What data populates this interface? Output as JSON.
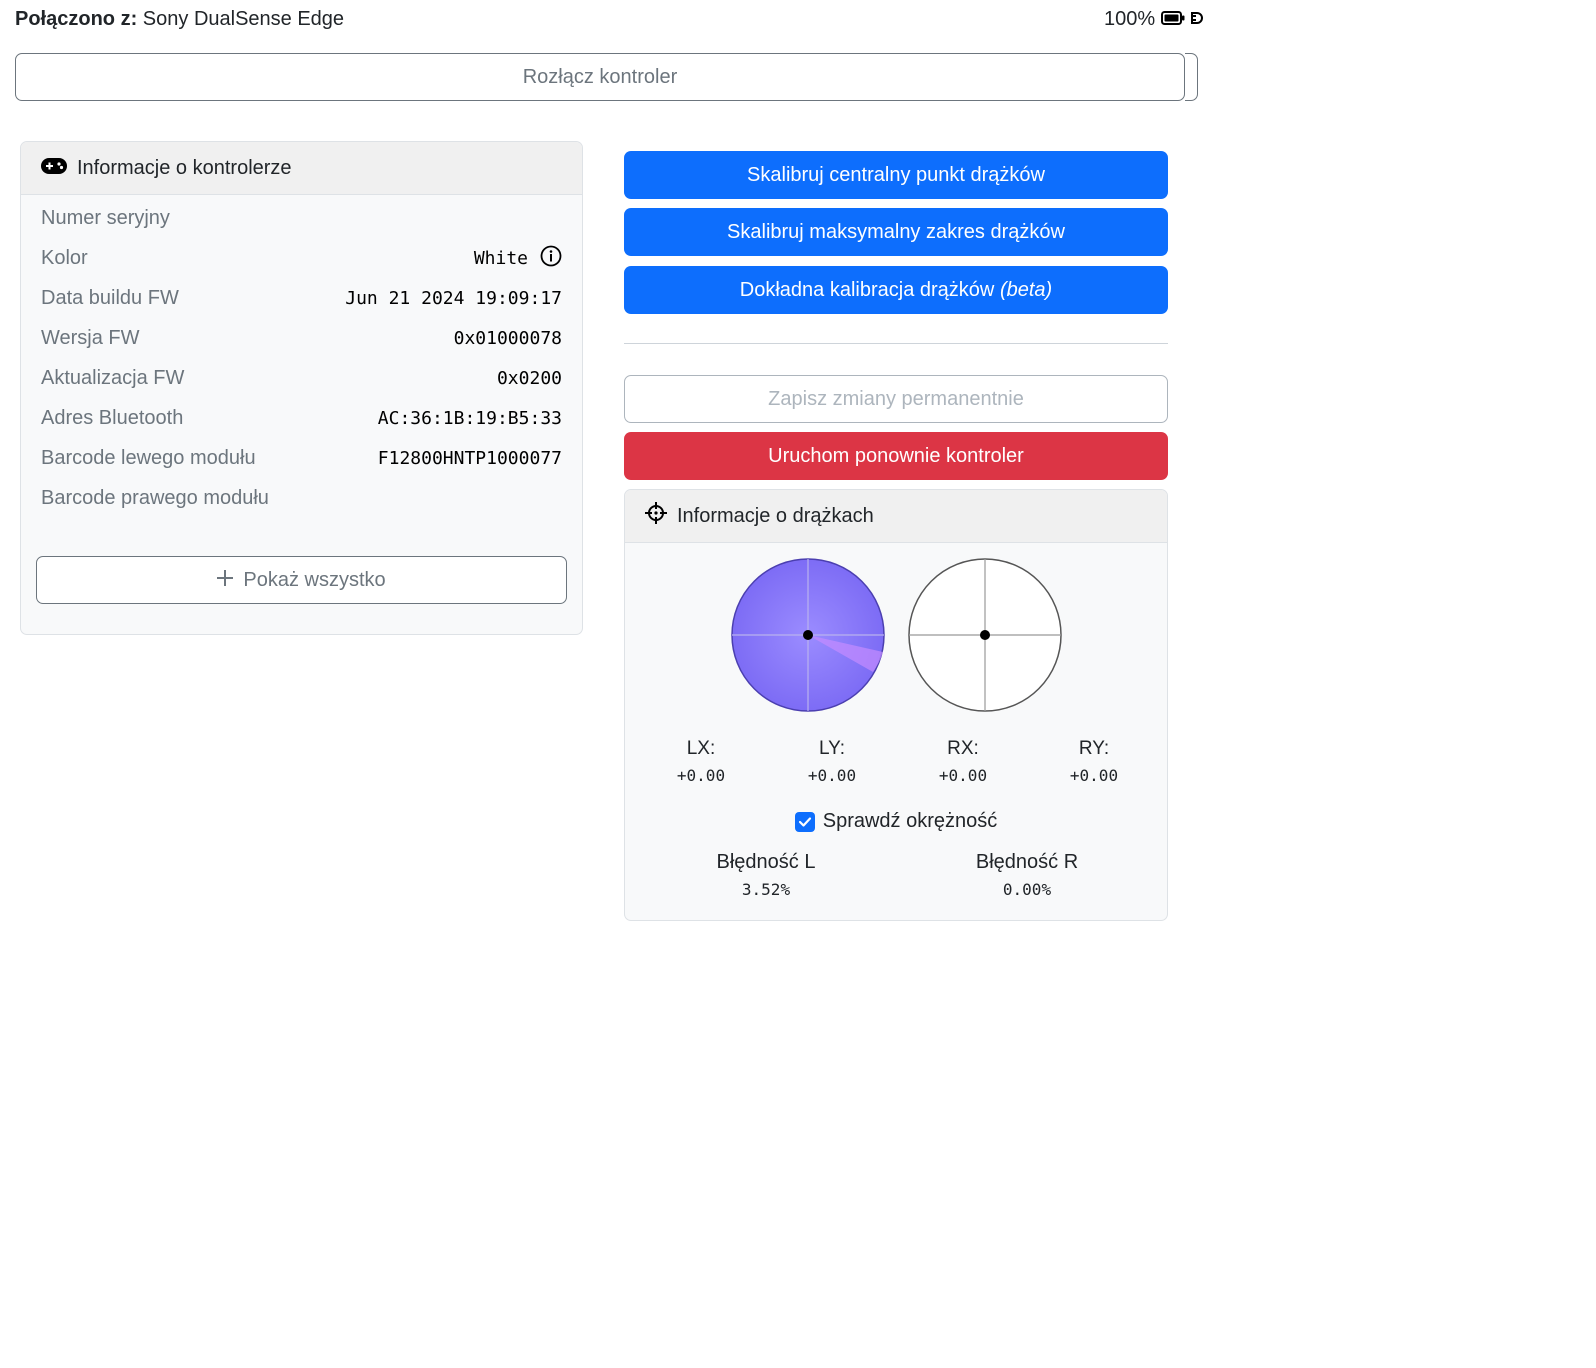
{
  "header": {
    "connected_label": "Połączono z:",
    "device_name": "Sony DualSense Edge",
    "battery_percent": "100%",
    "battery_icon": "battery-full-icon",
    "plug_icon": "plug-icon"
  },
  "disconnect_label": "Rozłącz kontroler",
  "controller_info": {
    "title": "Informacje o kontrolerze",
    "icon": "gamepad-icon",
    "rows": [
      {
        "label": "Numer seryjny",
        "value": ""
      },
      {
        "label": "Kolor",
        "value": "White"
      },
      {
        "label": "Data buildu FW",
        "value": "Jun 21 2024 19:09:17"
      },
      {
        "label": "Wersja FW",
        "value": "0x01000078"
      },
      {
        "label": "Aktualizacja FW",
        "value": "0x0200"
      },
      {
        "label": "Adres Bluetooth",
        "value": "AC:36:1B:19:B5:33"
      },
      {
        "label": "Barcode lewego modułu",
        "value": "F12800HNTP1000077"
      },
      {
        "label": "Barcode prawego modułu",
        "value": ""
      }
    ],
    "show_all_label": "Pokaż wszystko"
  },
  "actions": {
    "calibrate_center": "Skalibruj centralny punkt drążków",
    "calibrate_range": "Skalibruj maksymalny zakres drążków",
    "fine_calibration": "Dokładna kalibracja drążków",
    "fine_calibration_suffix": "(beta)",
    "save_permanent": "Zapisz zmiany permanentnie",
    "reboot_controller": "Uruchom ponownie kontroler"
  },
  "sticks": {
    "title": "Informacje o drążkach",
    "icon": "crosshair-icon",
    "left_stick": {
      "x": 0.0,
      "y": 0.0,
      "fill_color": "#8b7cff"
    },
    "right_stick": {
      "x": 0.0,
      "y": 0.0
    },
    "axes": [
      {
        "label": "LX:",
        "value": "+0.00"
      },
      {
        "label": "LY:",
        "value": "+0.00"
      },
      {
        "label": "RX:",
        "value": "+0.00"
      },
      {
        "label": "RY:",
        "value": "+0.00"
      }
    ],
    "check_circularity_label": "Sprawdź okrężność",
    "check_circularity_checked": true,
    "error_left_label": "Błędność L",
    "error_left_value": "3.52%",
    "error_right_label": "Błędność R",
    "error_right_value": "0.00%"
  },
  "colors": {
    "primary": "#0d6efd",
    "danger": "#dc3545",
    "secondary": "#6c757d"
  }
}
